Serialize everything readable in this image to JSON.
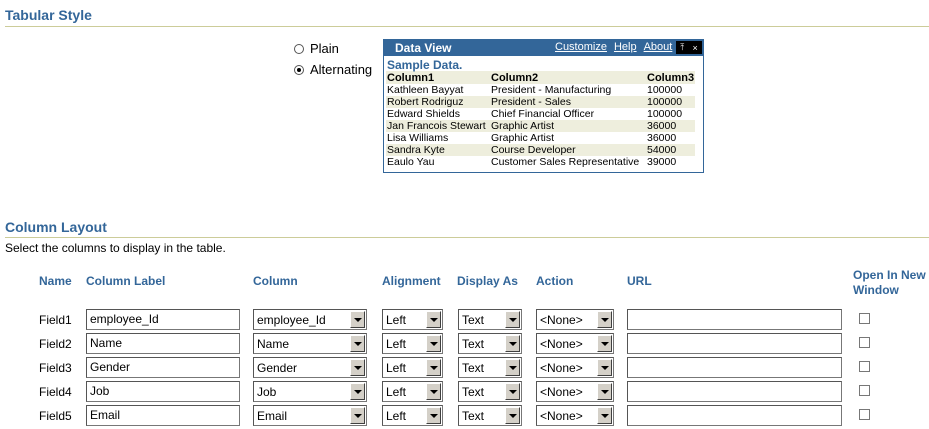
{
  "tabular_style": {
    "title": "Tabular Style",
    "options": [
      {
        "label": "Plain",
        "checked": false
      },
      {
        "label": "Alternating",
        "checked": true
      }
    ]
  },
  "data_view": {
    "title": "Data View",
    "links": [
      "Customize",
      "Help",
      "About"
    ],
    "controls": [
      "⤒",
      "×"
    ],
    "sample_label": "Sample Data.",
    "columns": [
      "Column1",
      "Column2",
      "Column3"
    ],
    "rows": [
      [
        "Kathleen Bayyat",
        "President - Manufacturing",
        "100000"
      ],
      [
        "Robert Rodriguz",
        "President - Sales",
        "100000"
      ],
      [
        "Edward Shields",
        "Chief Financial Officer",
        "100000"
      ],
      [
        "Jan Francois Stewart",
        "Graphic Artist",
        "36000"
      ],
      [
        "Lisa Williams",
        "Graphic Artist",
        "36000"
      ],
      [
        "Sandra Kyte",
        "Course Developer",
        "54000"
      ],
      [
        "Eaulo Yau",
        "Customer Sales Representative",
        "39000"
      ]
    ]
  },
  "column_layout": {
    "title": "Column Layout",
    "instructions": "Select the columns to display in the table.",
    "headers": {
      "name": "Name",
      "column_label": "Column Label",
      "column": "Column",
      "alignment": "Alignment",
      "display_as": "Display As",
      "action": "Action",
      "url": "URL",
      "open_new_window_1": "Open In New",
      "open_new_window_2": "Window"
    },
    "rows": [
      {
        "name": "Field1",
        "label": "employee_Id",
        "column": "employee_Id",
        "alignment": "Left",
        "display_as": "Text",
        "action": "<None>",
        "url": "",
        "new_window": false
      },
      {
        "name": "Field2",
        "label": "Name",
        "column": "Name",
        "alignment": "Left",
        "display_as": "Text",
        "action": "<None>",
        "url": "",
        "new_window": false
      },
      {
        "name": "Field3",
        "label": "Gender",
        "column": "Gender",
        "alignment": "Left",
        "display_as": "Text",
        "action": "<None>",
        "url": "",
        "new_window": false
      },
      {
        "name": "Field4",
        "label": "Job",
        "column": "Job",
        "alignment": "Left",
        "display_as": "Text",
        "action": "<None>",
        "url": "",
        "new_window": false
      },
      {
        "name": "Field5",
        "label": "Email",
        "column": "Email",
        "alignment": "Left",
        "display_as": "Text",
        "action": "<None>",
        "url": "",
        "new_window": false
      }
    ]
  }
}
